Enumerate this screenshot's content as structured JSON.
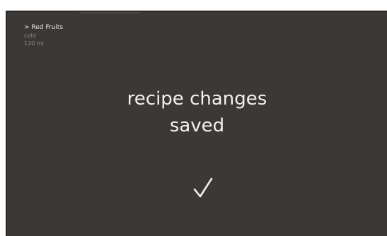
{
  "recipe": {
    "name": "> Red Fruits",
    "temperature": "cold",
    "volume": "120 ml"
  },
  "message": {
    "line1": "recipe changes",
    "line2": "saved"
  },
  "icons": {
    "confirm": "checkmark-icon"
  },
  "colors": {
    "screen_background": "#3b3835",
    "text_primary": "#f3f1ec",
    "text_secondary": "#8e8a84"
  }
}
